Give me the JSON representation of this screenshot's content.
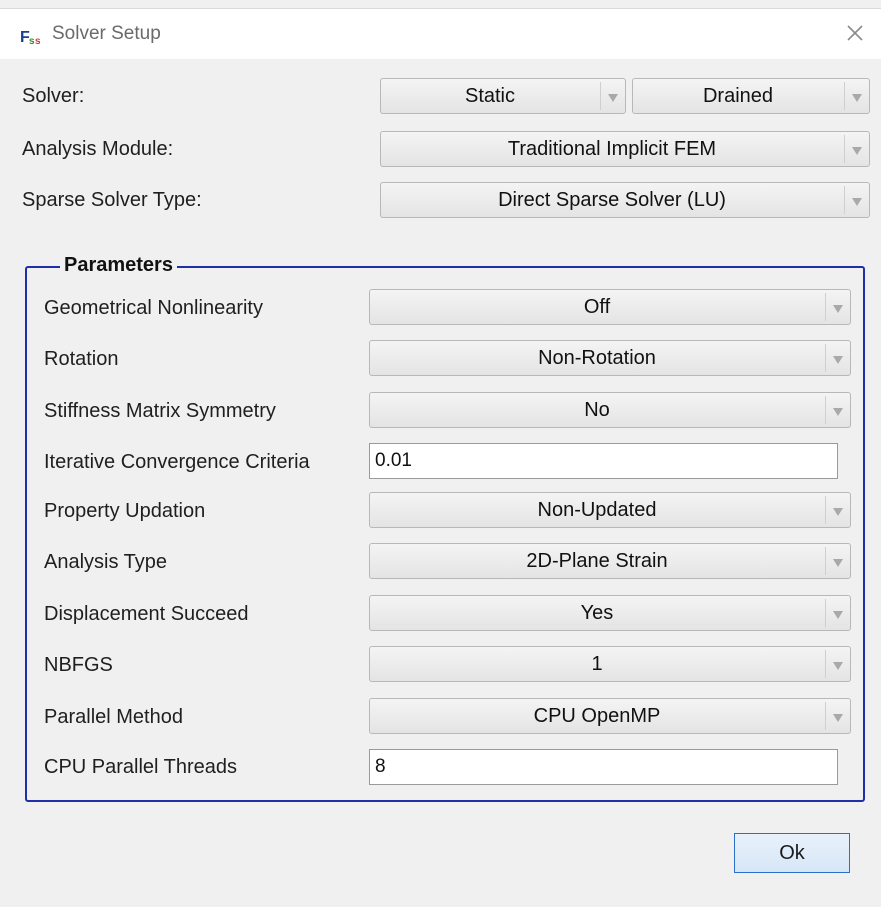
{
  "window": {
    "title": "Solver Setup",
    "icon": "fs-app-icon",
    "close_icon": "close-icon"
  },
  "solver": {
    "label": "Solver:",
    "option1": "Static",
    "option2": "Drained"
  },
  "analysis_module": {
    "label": "Analysis Module:",
    "value": "Traditional Implicit FEM"
  },
  "sparse_solver": {
    "label": "Sparse Solver Type:",
    "value": "Direct Sparse Solver (LU)"
  },
  "parameters": {
    "title": "Parameters",
    "rows": [
      {
        "label": "Geometrical Nonlinearity",
        "type": "combo",
        "value": "Off"
      },
      {
        "label": "Rotation",
        "type": "combo",
        "value": "Non-Rotation"
      },
      {
        "label": "Stiffness Matrix Symmetry",
        "type": "combo",
        "value": "No"
      },
      {
        "label": "Iterative Convergence Criteria",
        "type": "text",
        "value": "0.01"
      },
      {
        "label": "Property Updation",
        "type": "combo",
        "value": "Non-Updated"
      },
      {
        "label": "Analysis Type",
        "type": "combo",
        "value": "2D-Plane Strain"
      },
      {
        "label": "Displacement Succeed",
        "type": "combo",
        "value": "Yes"
      },
      {
        "label": "NBFGS",
        "type": "combo",
        "value": "1"
      },
      {
        "label": "Parallel Method",
        "type": "combo",
        "value": "CPU OpenMP"
      },
      {
        "label": "CPU Parallel Threads",
        "type": "text",
        "value": "8"
      }
    ]
  },
  "buttons": {
    "ok": "Ok"
  },
  "colors": {
    "group_border": "#1f2fa8",
    "ok_border": "#2a6fc9"
  }
}
